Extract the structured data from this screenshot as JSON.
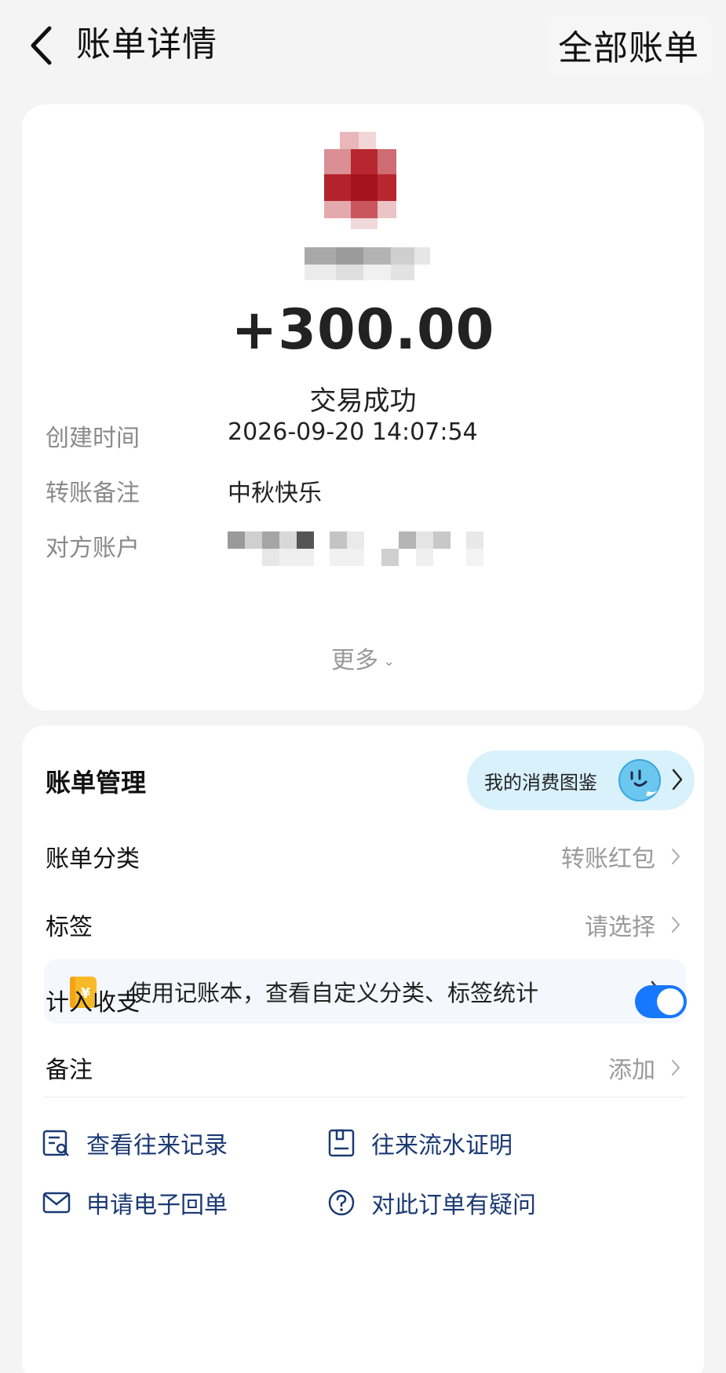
{
  "nav": {
    "title": "账单详情",
    "right_button": "全部账单"
  },
  "summary": {
    "amount": "+300.00",
    "status": "交易成功",
    "rows": [
      {
        "label": "创建时间",
        "value": "2026-09-20 14:07:54"
      },
      {
        "label": "转账备注",
        "value": "中秋快乐"
      },
      {
        "label": "对方账户",
        "value": ""
      }
    ],
    "more_label": "更多"
  },
  "management": {
    "title": "账单管理",
    "pill_label": "我的消费图鉴",
    "category": {
      "label": "账单分类",
      "value": "转账红包"
    },
    "tag": {
      "label": "标签",
      "value": "请选择"
    },
    "banner_text": "使用记账本，查看自定义分类、标签统计",
    "count_toggle": {
      "label": "计入收支",
      "on": true
    },
    "note": {
      "label": "备注",
      "value": "添加"
    },
    "actions": [
      {
        "label": "查看往来记录",
        "icon": "records-search-icon"
      },
      {
        "label": "往来流水证明",
        "icon": "document-icon"
      },
      {
        "label": "申请电子回单",
        "icon": "mail-icon"
      },
      {
        "label": "对此订单有疑问",
        "icon": "question-icon"
      }
    ]
  },
  "colors": {
    "accent": "#1677ff",
    "pill_bg": "#d9f1fb",
    "banner_icon": "#f7b928"
  }
}
